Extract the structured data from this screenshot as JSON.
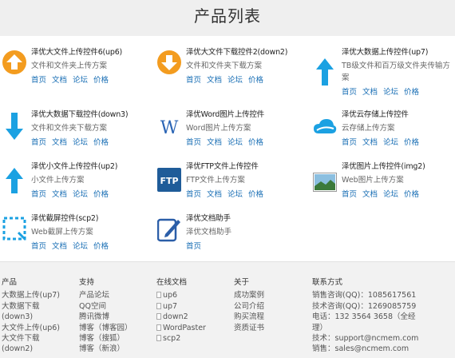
{
  "header": {
    "title": "产品列表"
  },
  "products": [
    {
      "title": "泽优大文件上传控件6(up6)",
      "desc": "文件和文件夹上传方案",
      "icon": "orange-up-arrow-icon"
    },
    {
      "title": "泽优大文件下载控件2(down2)",
      "desc": "文件和文件夹下载方案",
      "icon": "orange-down-arrow-icon"
    },
    {
      "title": "泽优大数据上传控件(up7)",
      "desc": "TB级文件和百万级文件夹传输方案",
      "icon": "blue-up-arrow-icon"
    },
    {
      "title": "泽优大数据下载控件(down3)",
      "desc": "文件和文件夹下载方案",
      "icon": "blue-down-arrow-icon"
    },
    {
      "title": "泽优Word图片上传控件",
      "desc": "Word图片上传方案",
      "icon": "word-w-icon"
    },
    {
      "title": "泽优云存储上传控件",
      "desc": "云存储上传方案",
      "icon": "cloud-icon"
    },
    {
      "title": "泽优小文件上传控件(up2)",
      "desc": "小文件上传方案",
      "icon": "blue-up-arrow-icon"
    },
    {
      "title": "泽优FTP文件上传控件",
      "desc": "FTP文件上传方案",
      "icon": "ftp-icon"
    },
    {
      "title": "泽优图片上传控件(img2)",
      "desc": "Web图片上传方案",
      "icon": "landscape-image-icon"
    },
    {
      "title": "泽优截屏控件(scp2)",
      "desc": "Web截屏上传方案",
      "icon": "screen-capture-icon"
    },
    {
      "title": "泽优文档助手",
      "desc": "泽优文档助手",
      "icon": "pen-document-icon"
    }
  ],
  "links": {
    "full": [
      "首页",
      "文档",
      "论坛",
      "价格"
    ],
    "home_only": [
      "首页"
    ]
  },
  "footer": {
    "products": {
      "heading": "产品",
      "items": [
        "大数据上传(up7)",
        "大数据下载",
        "(down3)",
        "大文件上传(up6)",
        "大文件下载",
        "(down2)"
      ]
    },
    "support": {
      "heading": "支持",
      "items": [
        "产品论坛",
        "QQ空间",
        "腾讯微博",
        "博客（博客园）",
        "博客（搜狐）",
        "博客（新浪）"
      ]
    },
    "docs": {
      "heading": "在线文档",
      "items": [
        "up6",
        "up7",
        "down2",
        "WordPaster",
        "scp2"
      ]
    },
    "about": {
      "heading": "关于",
      "items": [
        "成功案例",
        "公司介绍",
        "购买流程",
        "资质证书"
      ]
    },
    "contact": {
      "heading": "联系方式",
      "items": [
        "销售咨询(QQ)：1085617561",
        "技术咨询(QQ)：1269085759",
        "电话：132 3564 3658（全经",
        "理）",
        "技术：support@ncmem.com",
        "销售：sales@ncmem.com"
      ]
    }
  },
  "colors": {
    "link": "#1a6fb5",
    "orange": "#f39c1f",
    "blue": "#1ba1e2",
    "footer_bg": "#f2f2f2",
    "header_bg": "#efefef"
  }
}
